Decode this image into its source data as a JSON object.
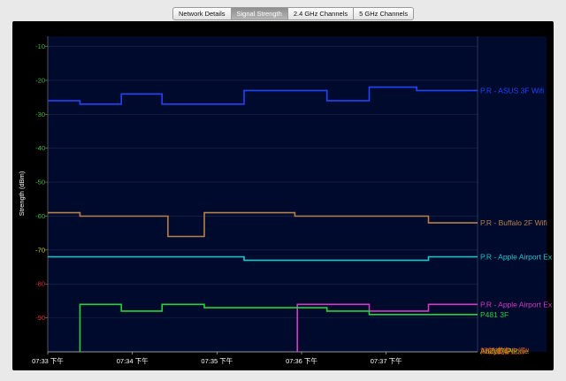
{
  "tabs": [
    {
      "label": "Network Details",
      "active": false
    },
    {
      "label": "Signal Strength",
      "active": true
    },
    {
      "label": "2.4 GHz Channels",
      "active": false
    },
    {
      "label": "5 GHz Channels",
      "active": false
    }
  ],
  "chart_data": {
    "type": "line",
    "title": "",
    "ylabel": "Strength (dBm)",
    "xlabel": "",
    "ylim": [
      -100,
      -7
    ],
    "xlim": [
      0,
      5.08
    ],
    "x_unit": "minutes after 07:33",
    "x_ticks": [
      {
        "x": 0,
        "label": "07:33 下午"
      },
      {
        "x": 1,
        "label": "07:34 下午"
      },
      {
        "x": 2,
        "label": "07:35 下午"
      },
      {
        "x": 3,
        "label": "07:36 下午"
      },
      {
        "x": 4,
        "label": "07:37 下午"
      }
    ],
    "y_ticks": [
      {
        "v": -10,
        "label": "-10",
        "color": "#34c134"
      },
      {
        "v": -20,
        "label": "-20",
        "color": "#34c134"
      },
      {
        "v": -30,
        "label": "-30",
        "color": "#34c134"
      },
      {
        "v": -40,
        "label": "-40",
        "color": "#34c134"
      },
      {
        "v": -50,
        "label": "-50",
        "color": "#34c134"
      },
      {
        "v": -60,
        "label": "-60",
        "color": "#34c134"
      },
      {
        "v": -70,
        "label": "-70",
        "color": "#d8d800"
      },
      {
        "v": -80,
        "label": "-80",
        "color": "#e03030"
      },
      {
        "v": -90,
        "label": "-90",
        "color": "#e03030"
      }
    ],
    "grid": true,
    "series": [
      {
        "name": "P.R - ASUS 3F Wifi",
        "color": "#1f44ff",
        "x": [
          0,
          0.38,
          0.38,
          0.87,
          0.87,
          1.35,
          1.35,
          2.32,
          2.32,
          3.3,
          3.3,
          3.8,
          3.8,
          4.36,
          4.36,
          5.08
        ],
        "values": [
          -26,
          -26,
          -27,
          -27,
          -24,
          -24,
          -27,
          -27,
          -23,
          -23,
          -26,
          -26,
          -22,
          -22,
          -23,
          -23
        ]
      },
      {
        "name": "P.R - Buffalo 2F Wifi",
        "color": "#b5804a",
        "x": [
          0,
          0.38,
          0.38,
          1.42,
          1.42,
          1.85,
          1.85,
          2.92,
          2.92,
          4.5,
          4.5,
          5.08
        ],
        "values": [
          -59,
          -59,
          -60,
          -60,
          -66,
          -66,
          -59,
          -59,
          -60,
          -60,
          -62,
          -62
        ]
      },
      {
        "name": "P.R - Apple Airport Ex",
        "color": "#18c8d0",
        "x": [
          0,
          2.32,
          2.32,
          4.5,
          4.5,
          5.08
        ],
        "values": [
          -72,
          -72,
          -73,
          -73,
          -72,
          -72
        ]
      },
      {
        "name": "P.R - Apple Airport Ex",
        "color": "#d23bc2",
        "x": [
          2.95,
          2.95,
          3.8,
          3.8,
          4.5,
          4.5,
          5.08
        ],
        "values": [
          -100,
          -86,
          -86,
          -88,
          -88,
          -86,
          -86
        ]
      },
      {
        "name": "P481   3F",
        "color": "#22d33a",
        "x": [
          0.38,
          0.38,
          0.87,
          0.87,
          1.35,
          1.35,
          1.85,
          1.85,
          3.3,
          3.3,
          3.8,
          3.8,
          5.08
        ],
        "values": [
          -100,
          -86,
          -86,
          -88,
          -88,
          -86,
          -86,
          -87,
          -87,
          -88,
          -88,
          -89,
          -89
        ]
      }
    ],
    "bottom_labels": [
      {
        "text": "A8Z8D4AP",
        "color": "#e8a020"
      },
      {
        "text": "Andy的iPhone",
        "color": "#c8c800"
      },
      {
        "text": "如鼠讓您上課!!",
        "color": "#e05030"
      }
    ]
  }
}
